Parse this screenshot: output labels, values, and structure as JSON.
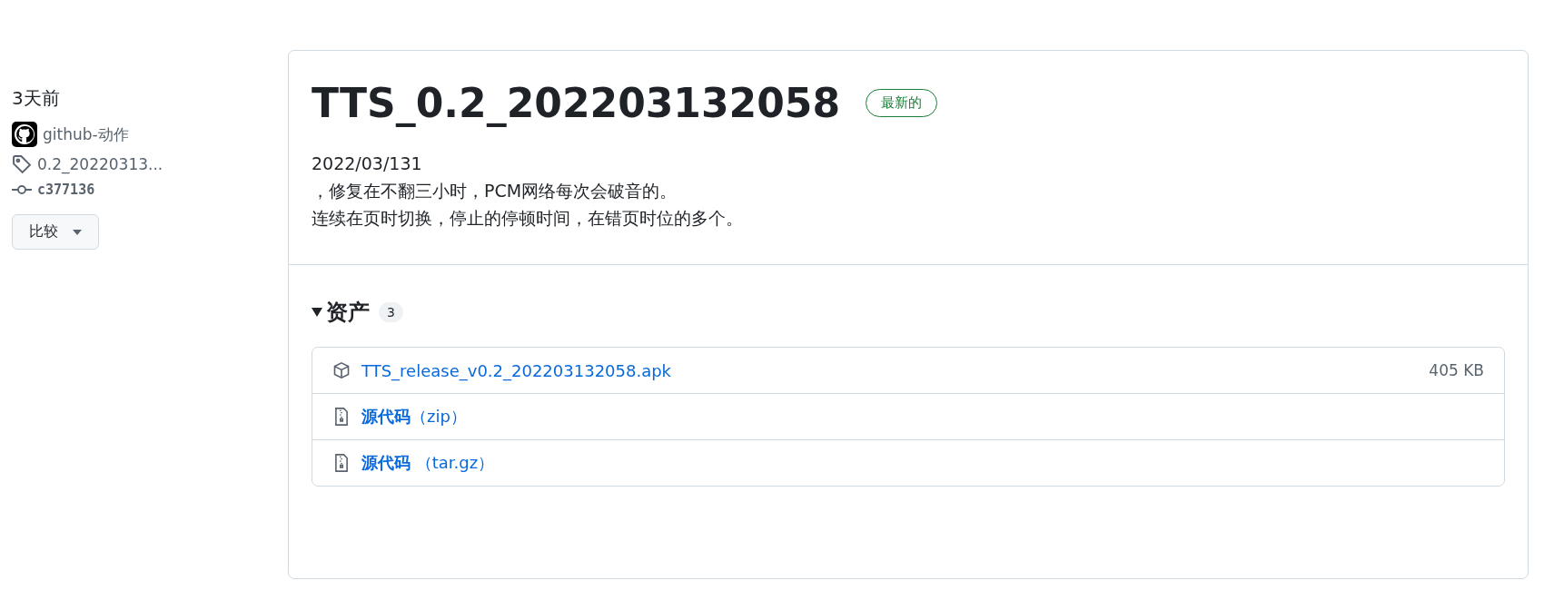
{
  "sidebar": {
    "time": "3天前",
    "author": "github-动作",
    "tag": "0.2_20220313...",
    "commit": "c377136",
    "compare_button": "比较"
  },
  "release": {
    "title": "TTS_0.2_202203132058",
    "badge": "最新的",
    "notes": [
      "2022/03/131",
      "，修复在不翻三小时，PCM网络每次会破音的。",
      "连续在页时切换，停止的停顿时间，在错页时位的多个。"
    ],
    "assets": {
      "heading": "资产",
      "count": "3",
      "expanded": true,
      "items": [
        {
          "kind": "package",
          "name": "TTS_release_v0.2_202203132058.apk",
          "size": "405 KB"
        },
        {
          "kind": "archive",
          "name": "**源代码**（zip）"
        },
        {
          "kind": "archive",
          "name": "**源代码** （tar.gz）"
        }
      ]
    }
  }
}
